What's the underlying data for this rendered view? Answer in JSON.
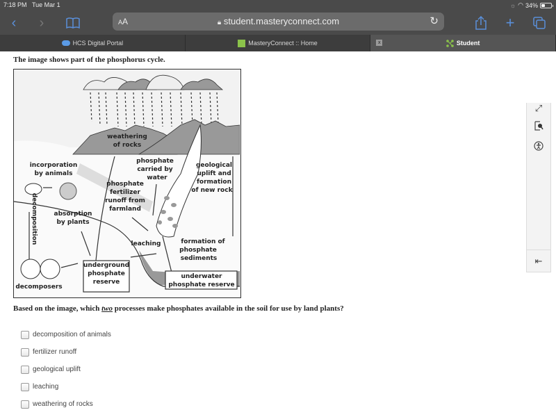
{
  "status_bar": {
    "time": "7:18 PM",
    "date": "Tue Mar 1",
    "battery_percent": "34%",
    "battery_level": 0.34
  },
  "browser": {
    "url": "student.masteryconnect.com",
    "text_size_label": "AA",
    "icons": {
      "back": "chevron-left-icon",
      "forward": "chevron-right-icon",
      "bookmarks": "book-icon",
      "share": "share-icon",
      "new_tab": "plus-icon",
      "tabs": "tabs-icon",
      "reload": "reload-icon",
      "lock": "lock-icon"
    }
  },
  "tabs": [
    {
      "label": "HCS Digital Portal",
      "icon": "cloud-icon",
      "active": false
    },
    {
      "label": "MasteryConnect :: Home",
      "icon": "masteryconnect-icon",
      "active": false
    },
    {
      "label": "Student",
      "icon": "student-icon",
      "active": true,
      "close_label": "x"
    }
  ],
  "side_panel": {
    "icons": [
      "expand-icon",
      "magnifier-icon",
      "accessibility-icon",
      "collapse-panel-icon"
    ]
  },
  "question": {
    "stem": "The image shows part of the phosphorus cycle.",
    "prompt_before": "Based on the image, which ",
    "prompt_emphasis": "two",
    "prompt_after": " processes make phosphates available in the soil for use by land plants?",
    "options": [
      {
        "label": "decomposition of animals",
        "checked": false
      },
      {
        "label": "fertilizer runoff",
        "checked": false
      },
      {
        "label": "geological uplift",
        "checked": false
      },
      {
        "label": "leaching",
        "checked": false
      },
      {
        "label": "weathering of rocks",
        "checked": false
      }
    ]
  },
  "diagram": {
    "labels": {
      "weathering": [
        "weathering",
        "of rocks"
      ],
      "incorporation": [
        "incorporation",
        "by animals"
      ],
      "carried": [
        "phosphate",
        "carried by",
        "water"
      ],
      "geological": [
        "geological",
        "uplift and",
        "formation",
        "of new rock"
      ],
      "fertilizer": [
        "phosphate",
        "fertilizer",
        "runoff from",
        "farmland"
      ],
      "absorption": [
        "absorption",
        "by plants"
      ],
      "decomposition": "decomposition",
      "leaching": "leaching",
      "sediments": [
        "formation of",
        "phosphate",
        "sediments"
      ],
      "underground": [
        "underground",
        "phosphate",
        "reserve"
      ],
      "underwater": [
        "underwater",
        "phosphate reserve"
      ],
      "decomposers": "decomposers"
    }
  }
}
